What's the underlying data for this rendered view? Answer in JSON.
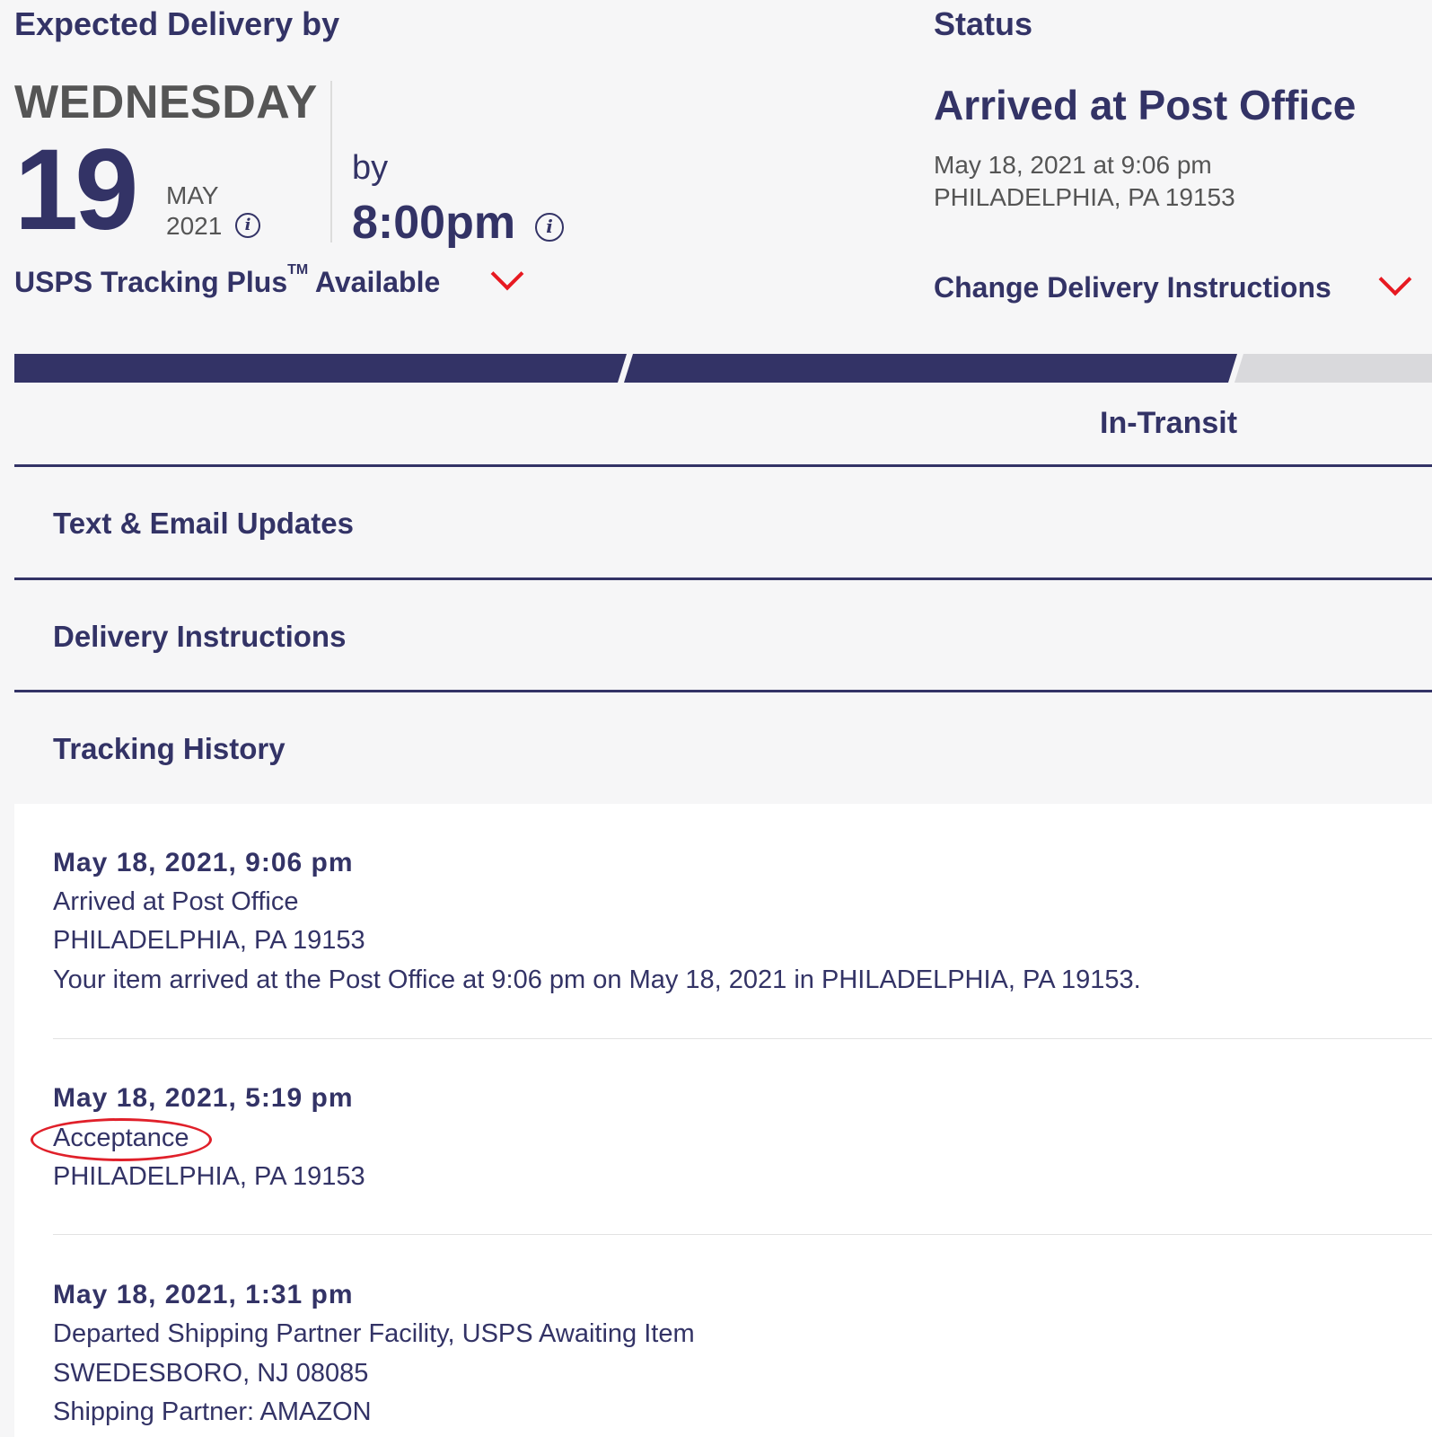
{
  "expected": {
    "label": "Expected Delivery by",
    "weekday": "WEDNESDAY",
    "day": "19",
    "month": "MAY",
    "year": "2021",
    "by": "by",
    "time": "8:00pm",
    "info_icon": "info-icon"
  },
  "tracking_plus": {
    "label_main": "USPS Tracking Plus",
    "trademark": "TM",
    "label_rest": "Available",
    "chevron_icon": "chevron-down-icon"
  },
  "status": {
    "label": "Status",
    "title": "Arrived at Post Office",
    "datetime": "May 18, 2021 at 9:06 pm",
    "location": "PHILADELPHIA, PA 19153",
    "change_instructions": "Change Delivery Instructions"
  },
  "progress": {
    "segments_complete": 2,
    "segments_total": 3,
    "stage_label": "In-Transit"
  },
  "sections": {
    "text_email": "Text & Email Updates",
    "delivery_instructions": "Delivery Instructions",
    "tracking_history": "Tracking History"
  },
  "history": [
    {
      "datetime": "May 18, 2021, 9:06 pm",
      "status": "Arrived at Post Office",
      "location": "PHILADELPHIA, PA 19153",
      "detail": "Your item arrived at the Post Office at 9:06 pm on May 18, 2021 in PHILADELPHIA, PA 19153."
    },
    {
      "datetime": "May 18, 2021, 5:19 pm",
      "status": "Acceptance",
      "location": "PHILADELPHIA, PA 19153"
    },
    {
      "datetime": "May 18, 2021, 1:31 pm",
      "status": "Departed Shipping Partner Facility, USPS Awaiting Item",
      "location": "SWEDESBORO, NJ 08085",
      "detail": "Shipping Partner:  AMAZON"
    }
  ],
  "colors": {
    "navy": "#333366",
    "red": "#e71921",
    "grey_text": "#555555",
    "background": "#f6f6f7",
    "progress_inactive": "#d9d9dc"
  }
}
